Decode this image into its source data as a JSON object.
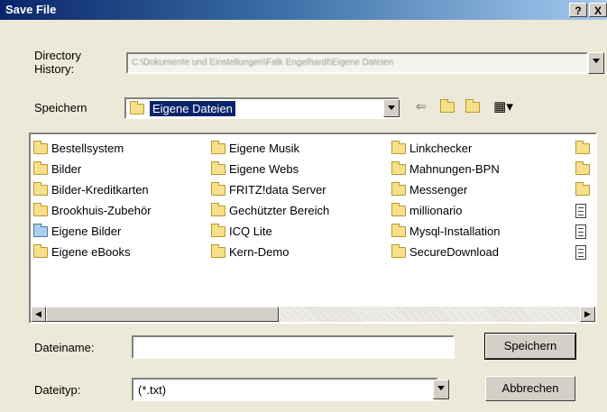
{
  "window": {
    "title": "Save File",
    "help_label": "?",
    "close_label": "X"
  },
  "history": {
    "label": "Directory History:",
    "value": "C:\\Dokumente und Einstellungen\\Falk Engelhardt\\Eigene Dateien"
  },
  "location": {
    "label": "Speichern",
    "value": "Eigene Dateien"
  },
  "toolbar": {
    "back_glyph": "⇐",
    "up_glyph": "⬑",
    "newfolder_glyph": "✱",
    "view_glyph": "▦▾"
  },
  "files": {
    "columns": [
      [
        {
          "name": "Bestellsystem",
          "icon": "folder-icon"
        },
        {
          "name": "Bilder",
          "icon": "folder-icon"
        },
        {
          "name": "Bilder-Kreditkarten",
          "icon": "folder-icon"
        },
        {
          "name": "Brookhuis-Zubehör",
          "icon": "folder-icon"
        },
        {
          "name": "Eigene Bilder",
          "icon": "picture-folder-icon"
        },
        {
          "name": "Eigene eBooks",
          "icon": "folder-icon"
        }
      ],
      [
        {
          "name": "Eigene Musik",
          "icon": "folder-icon"
        },
        {
          "name": "Eigene Webs",
          "icon": "folder-icon"
        },
        {
          "name": "FRITZ!data Server",
          "icon": "folder-icon"
        },
        {
          "name": "Gechützter Bereich",
          "icon": "folder-icon"
        },
        {
          "name": "ICQ Lite",
          "icon": "folder-icon"
        },
        {
          "name": "Kern-Demo",
          "icon": "folder-icon"
        }
      ],
      [
        {
          "name": "Linkchecker",
          "icon": "folder-icon"
        },
        {
          "name": "Mahnungen-BPN",
          "icon": "folder-icon"
        },
        {
          "name": "Messenger",
          "icon": "folder-icon"
        },
        {
          "name": "millionario",
          "icon": "folder-icon"
        },
        {
          "name": "Mysql-Installation",
          "icon": "folder-icon"
        },
        {
          "name": "SecureDownload",
          "icon": "folder-icon"
        }
      ],
      [
        {
          "name": "",
          "icon": "folder-icon"
        },
        {
          "name": "",
          "icon": "folder-icon"
        },
        {
          "name": "",
          "icon": "folder-icon"
        },
        {
          "name": "",
          "icon": "document-icon"
        },
        {
          "name": "",
          "icon": "document-icon"
        },
        {
          "name": "",
          "icon": "document-icon"
        }
      ]
    ]
  },
  "filename": {
    "label": "Dateiname:",
    "value": ""
  },
  "filetype": {
    "label": "Dateityp:",
    "value": "(*.txt)"
  },
  "buttons": {
    "save": "Speichern",
    "cancel": "Abbrechen"
  }
}
